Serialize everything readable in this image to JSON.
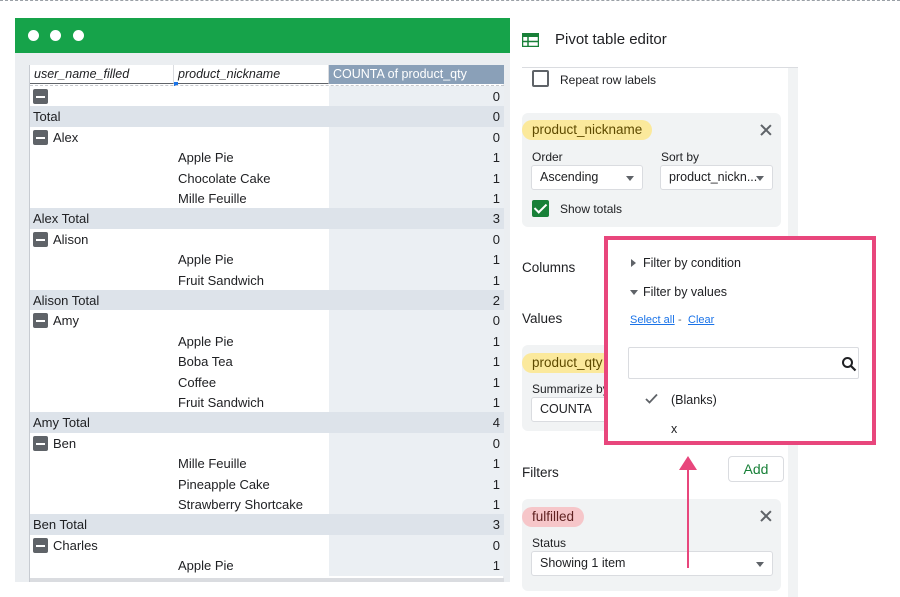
{
  "window": {
    "title": ""
  },
  "grid": {
    "headers": [
      "user_name_filled",
      "product_nickname",
      "COUNTA of product_qty"
    ],
    "rows": [
      {
        "type": "group",
        "c1": "",
        "c2": "",
        "c3": "0"
      },
      {
        "type": "total",
        "c1": "Total",
        "c2": "",
        "c3": "0"
      },
      {
        "type": "group",
        "c1": "Alex",
        "c2": "",
        "c3": "0"
      },
      {
        "type": "item",
        "c1": "",
        "c2": "Apple Pie",
        "c3": "1"
      },
      {
        "type": "item",
        "c1": "",
        "c2": "Chocolate Cake",
        "c3": "1"
      },
      {
        "type": "item",
        "c1": "",
        "c2": "Mille Feuille",
        "c3": "1"
      },
      {
        "type": "total",
        "c1": "Alex Total",
        "c2": "",
        "c3": "3"
      },
      {
        "type": "group",
        "c1": "Alison",
        "c2": "",
        "c3": "0"
      },
      {
        "type": "item",
        "c1": "",
        "c2": "Apple Pie",
        "c3": "1"
      },
      {
        "type": "item",
        "c1": "",
        "c2": "Fruit Sandwich",
        "c3": "1"
      },
      {
        "type": "total",
        "c1": "Alison Total",
        "c2": "",
        "c3": "2"
      },
      {
        "type": "group",
        "c1": "Amy",
        "c2": "",
        "c3": "0"
      },
      {
        "type": "item",
        "c1": "",
        "c2": "Apple Pie",
        "c3": "1"
      },
      {
        "type": "item",
        "c1": "",
        "c2": "Boba Tea",
        "c3": "1"
      },
      {
        "type": "item",
        "c1": "",
        "c2": "Coffee",
        "c3": "1"
      },
      {
        "type": "item",
        "c1": "",
        "c2": "Fruit Sandwich",
        "c3": "1"
      },
      {
        "type": "total",
        "c1": "Amy Total",
        "c2": "",
        "c3": "4"
      },
      {
        "type": "group",
        "c1": "Ben",
        "c2": "",
        "c3": "0"
      },
      {
        "type": "item",
        "c1": "",
        "c2": "Mille Feuille",
        "c3": "1"
      },
      {
        "type": "item",
        "c1": "",
        "c2": "Pineapple Cake",
        "c3": "1"
      },
      {
        "type": "item",
        "c1": "",
        "c2": "Strawberry Shortcake",
        "c3": "1"
      },
      {
        "type": "total",
        "c1": "Ben Total",
        "c2": "",
        "c3": "3"
      },
      {
        "type": "group",
        "c1": "Charles",
        "c2": "",
        "c3": "0"
      },
      {
        "type": "item",
        "c1": "",
        "c2": "Apple Pie",
        "c3": "1"
      }
    ]
  },
  "editor": {
    "title": "Pivot table editor",
    "repeat_row_labels": "Repeat row labels",
    "rows_card": {
      "chip": "product_nickname",
      "order_label": "Order",
      "sort_label": "Sort by",
      "order_value": "Ascending",
      "sort_value": "product_nickn...",
      "show_totals": "Show totals"
    },
    "columns_label": "Columns",
    "values_label": "Values",
    "values_card": {
      "chip": "product_qty",
      "summarize_label": "Summarize by",
      "summarize_value": "COUNTA"
    },
    "filters_label": "Filters",
    "add_label": "Add",
    "filter_card": {
      "chip": "fulfilled",
      "status_label": "Status",
      "status_value": "Showing 1 item"
    }
  },
  "popup": {
    "by_condition": "Filter by condition",
    "by_values": "Filter by values",
    "select_all": "Select all",
    "sep": " - ",
    "clear": "Clear",
    "search_placeholder": "",
    "values": [
      "(Blanks)",
      "x"
    ]
  },
  "colors": {
    "accent_green": "#16a34a",
    "highlight_pink": "#e8467c",
    "chip_yellow": "#fbe99c",
    "chip_red": "#f6c6c9"
  }
}
